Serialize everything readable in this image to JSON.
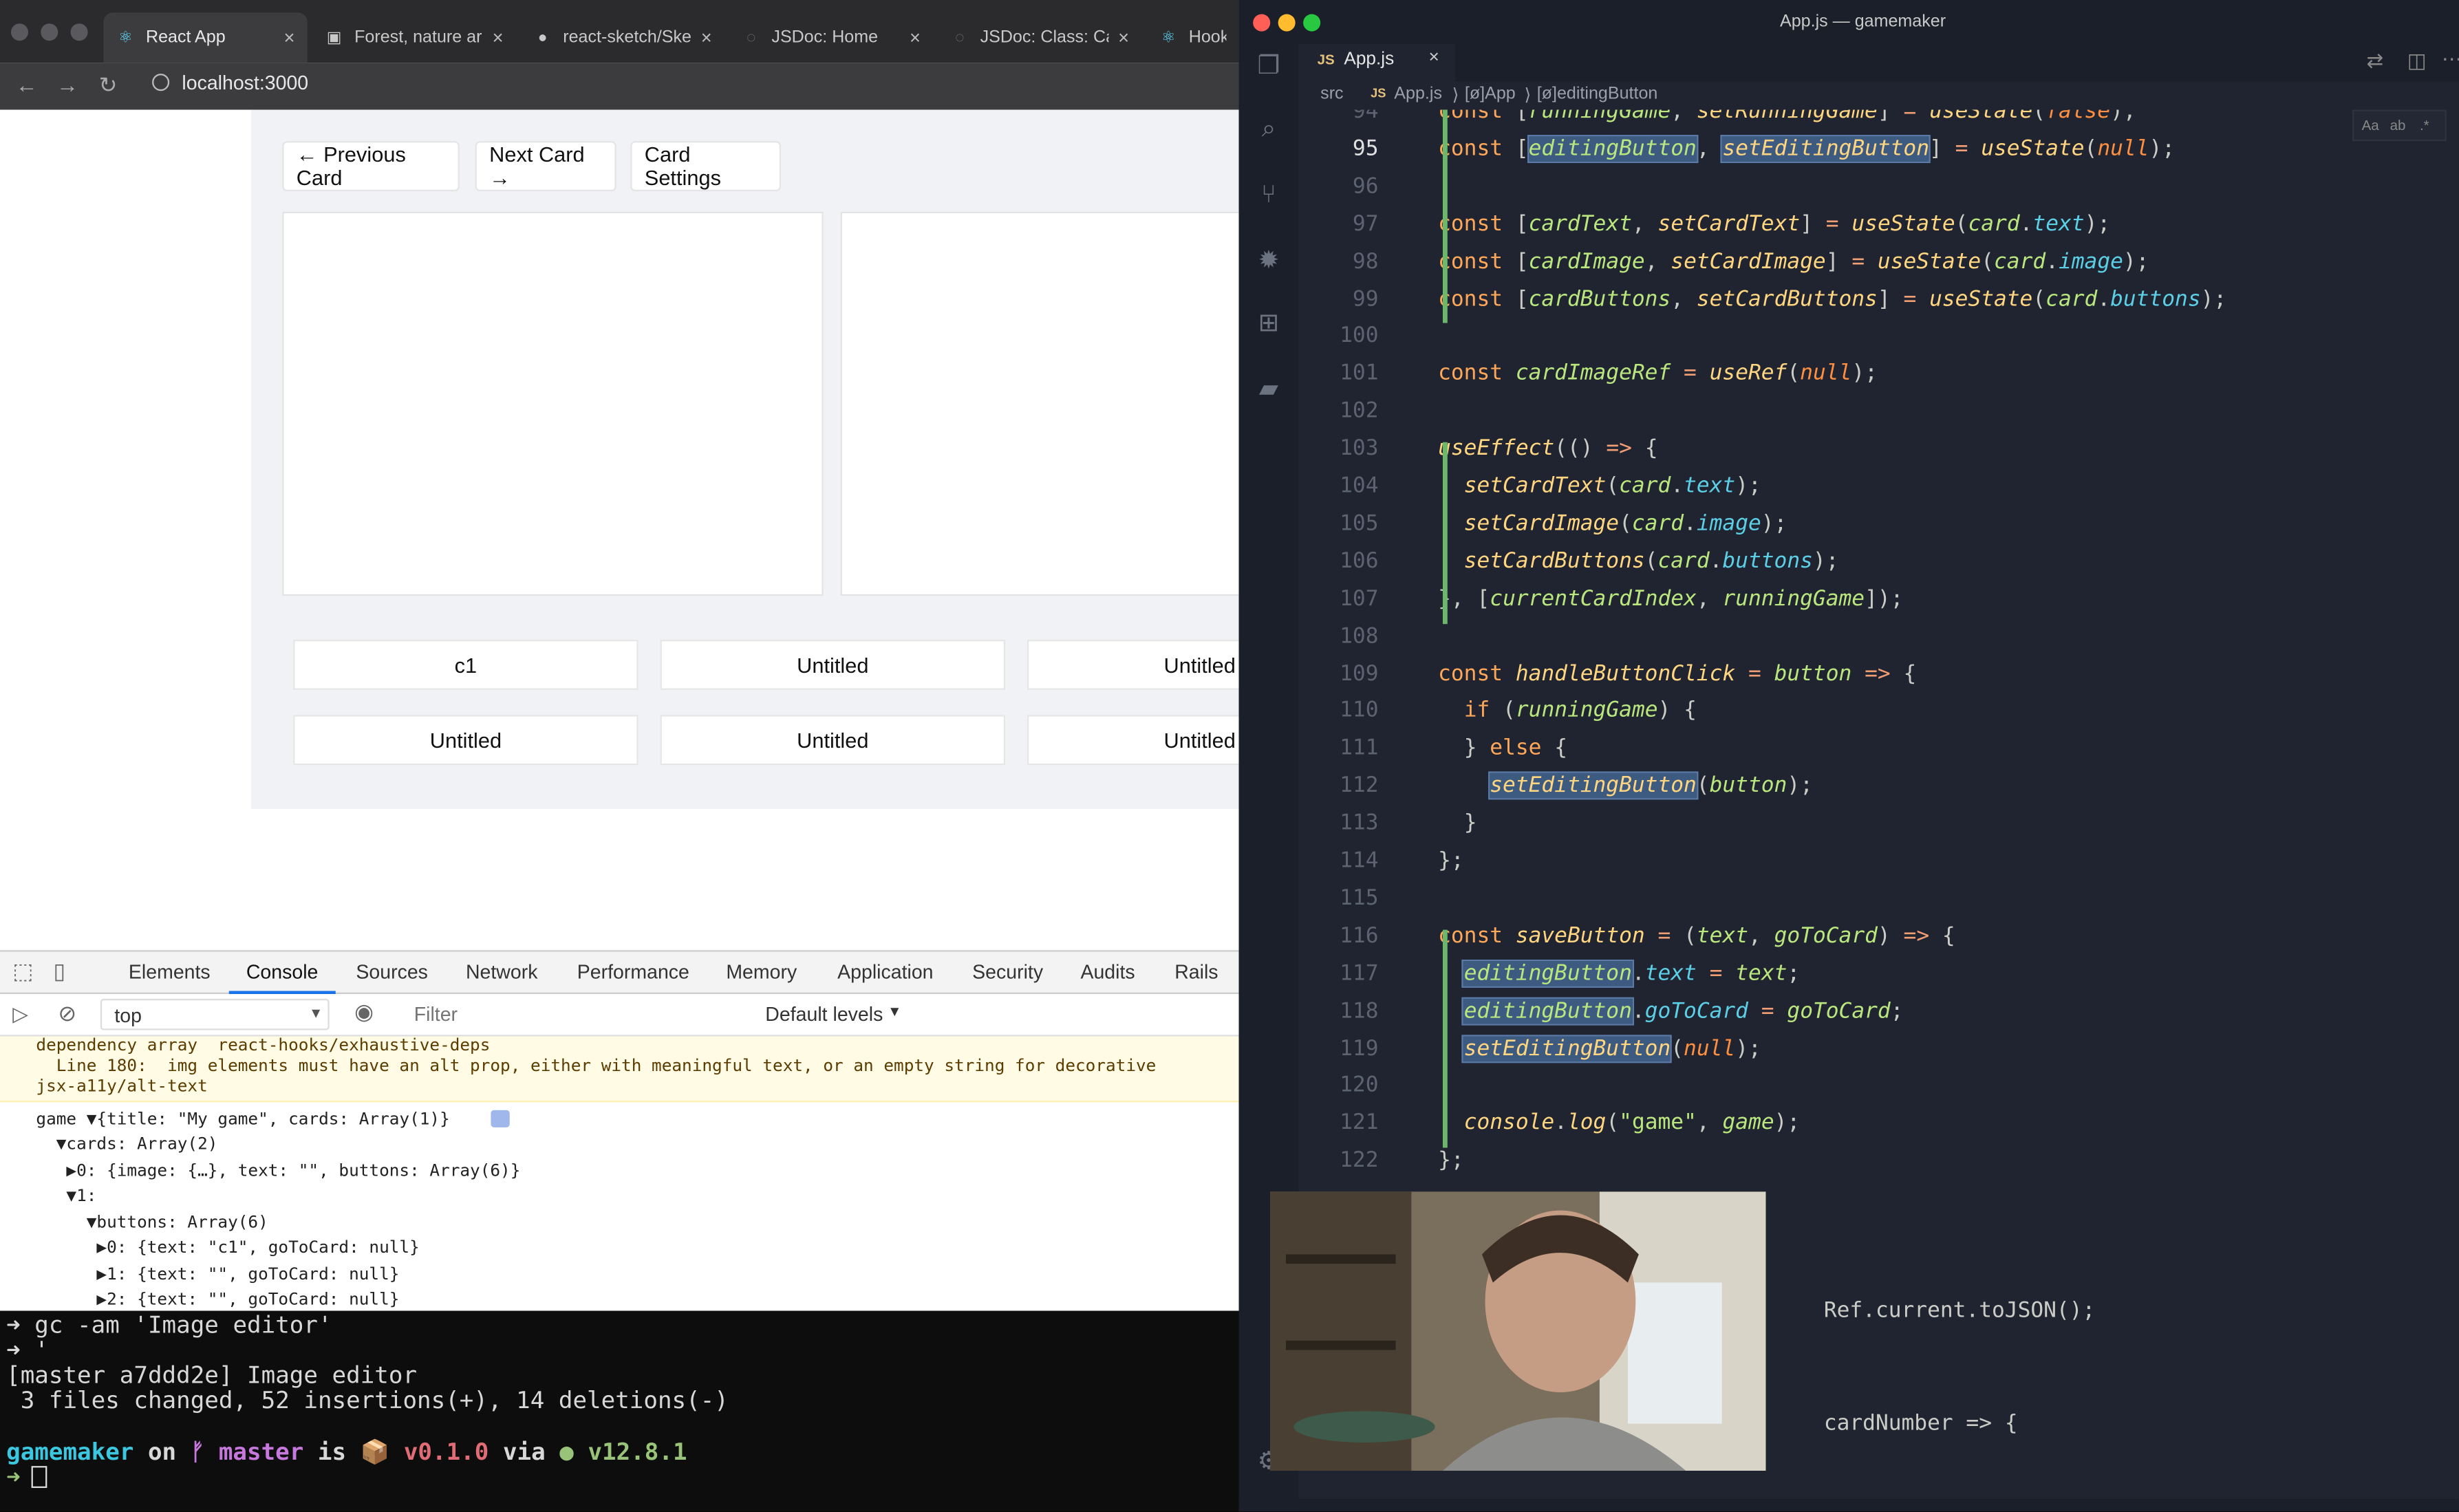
{
  "browser": {
    "tabs": [
      {
        "label": "React App",
        "icon": "react-icon"
      },
      {
        "label": "Forest, nature ar",
        "icon": "image-icon"
      },
      {
        "label": "react-sketch/Ske",
        "icon": "github-icon"
      },
      {
        "label": "JSDoc: Home",
        "icon": "globe-icon"
      },
      {
        "label": "JSDoc: Class: Ca",
        "icon": "globe-icon"
      },
      {
        "label": "Hooks",
        "icon": "react-icon"
      }
    ],
    "close_glyph": "×",
    "url": "localhost:3000"
  },
  "app": {
    "prev_label": "← Previous Card",
    "next_label": "Next Card →",
    "settings_label": "Card Settings",
    "buttons": [
      "c1",
      "Untitled",
      "Untitled",
      "Untitled",
      "Untitled",
      "Untitled"
    ]
  },
  "devtools": {
    "tabs": [
      "Elements",
      "Console",
      "Sources",
      "Network",
      "Performance",
      "Memory",
      "Application",
      "Security",
      "Audits",
      "Rails"
    ],
    "context": "top",
    "filter_placeholder": "Filter",
    "levels": "Default levels",
    "warning_lines": [
      "dependency array  react-hooks/exhaustive-deps",
      "  Line 180:  img elements must have an alt prop, either with meaningful text, or an empty string for decorative",
      "jsx-a11y/alt-text"
    ],
    "log_lines": [
      "game ▼{title: \"My game\", cards: Array(1)}",
      "  ▼cards: Array(2)",
      "   ▶0: {image: {…}, text: \"\", buttons: Array(6)}",
      "   ▼1:",
      "     ▼buttons: Array(6)",
      "      ▶0: {text: \"c1\", goToCard: null}",
      "      ▶1: {text: \"\", goToCard: null}",
      "      ▶2: {text: \"\", goToCard: null}"
    ]
  },
  "terminal": {
    "lines": [
      "➜ gc -am 'Image editor'",
      "➜ '",
      "[master a7ddd2e] Image editor",
      " 3 files changed, 52 insertions(+), 14 deletions(-)",
      "",
      "gamemaker on ᚠ master is 📦 v0.1.0 via ● v12.8.1",
      "➜ "
    ],
    "prompt_dir": "gamemaker",
    "on": " on ",
    "branch": "ᚠ master",
    "is": " is ",
    "pkg": "📦 v0.1.0",
    "via": " via ",
    "node": "● v12.8.1"
  },
  "vscode": {
    "title": "App.js — gamemaker",
    "tab": "App.js",
    "crumbs": [
      "src",
      "JS",
      "App.js",
      "⟩",
      "[ø]App",
      "⟩",
      "[ø]editingButton"
    ],
    "code_lines": [
      {
        "n": "94",
        "t": "const [runningGame, setRunningGame] = useState(false);"
      },
      {
        "n": "95",
        "t": "const [editingButton, setEditingButton] = useState(null);"
      },
      {
        "n": "96",
        "t": ""
      },
      {
        "n": "97",
        "t": "const [cardText, setCardText] = useState(card.text);"
      },
      {
        "n": "98",
        "t": "const [cardImage, setCardImage] = useState(card.image);"
      },
      {
        "n": "99",
        "t": "const [cardButtons, setCardButtons] = useState(card.buttons);"
      },
      {
        "n": "100",
        "t": ""
      },
      {
        "n": "101",
        "t": "const cardImageRef = useRef(null);"
      },
      {
        "n": "102",
        "t": ""
      },
      {
        "n": "103",
        "t": "useEffect(() => {"
      },
      {
        "n": "104",
        "t": "  setCardText(card.text);"
      },
      {
        "n": "105",
        "t": "  setCardImage(card.image);"
      },
      {
        "n": "106",
        "t": "  setCardButtons(card.buttons);"
      },
      {
        "n": "107",
        "t": "}, [currentCardIndex, runningGame]);"
      },
      {
        "n": "108",
        "t": ""
      },
      {
        "n": "109",
        "t": "const handleButtonClick = button => {"
      },
      {
        "n": "110",
        "t": "  if (runningGame) {"
      },
      {
        "n": "111",
        "t": "  } else {"
      },
      {
        "n": "112",
        "t": "    setEditingButton(button);"
      },
      {
        "n": "113",
        "t": "  }"
      },
      {
        "n": "114",
        "t": "};"
      },
      {
        "n": "115",
        "t": ""
      },
      {
        "n": "116",
        "t": "const saveButton = (text, goToCard) => {"
      },
      {
        "n": "117",
        "t": "  editingButton.text = text;"
      },
      {
        "n": "118",
        "t": "  editingButton.goToCard = goToCard;"
      },
      {
        "n": "119",
        "t": "  setEditingButton(null);"
      },
      {
        "n": "120",
        "t": ""
      },
      {
        "n": "121",
        "t": "  console.log(\"game\", game);"
      },
      {
        "n": "122",
        "t": "};"
      }
    ],
    "tail_lines": [
      "Ref.current.toJSON();",
      "cardNumber => {"
    ]
  },
  "colors": {
    "accent": "#1a73e8",
    "editor_bg": "#1f2430",
    "terminal_bg": "#0d0d0d"
  }
}
